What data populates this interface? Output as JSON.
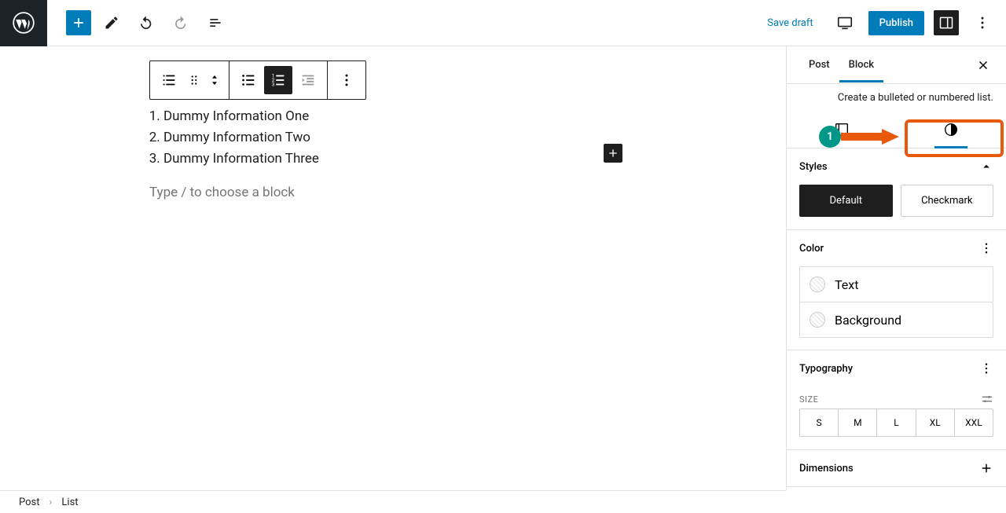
{
  "header": {
    "save_draft": "Save draft",
    "publish": "Publish"
  },
  "editor": {
    "list_items": [
      "Dummy Information One",
      "Dummy Information Two",
      "Dummy Information Three"
    ],
    "placeholder": "Type / to choose a block"
  },
  "sidebar": {
    "tabs": {
      "post": "Post",
      "block": "Block"
    },
    "desc": "Create a bulleted or numbered list.",
    "styles": {
      "title": "Styles",
      "default": "Default",
      "checkmark": "Checkmark"
    },
    "color": {
      "title": "Color",
      "text": "Text",
      "background": "Background"
    },
    "typography": {
      "title": "Typography",
      "size_label": "SIZE",
      "sizes": [
        "S",
        "M",
        "L",
        "XL",
        "XXL"
      ]
    },
    "dimensions": {
      "title": "Dimensions"
    }
  },
  "annotation": {
    "number": "1"
  },
  "breadcrumb": {
    "post": "Post",
    "item": "List"
  }
}
